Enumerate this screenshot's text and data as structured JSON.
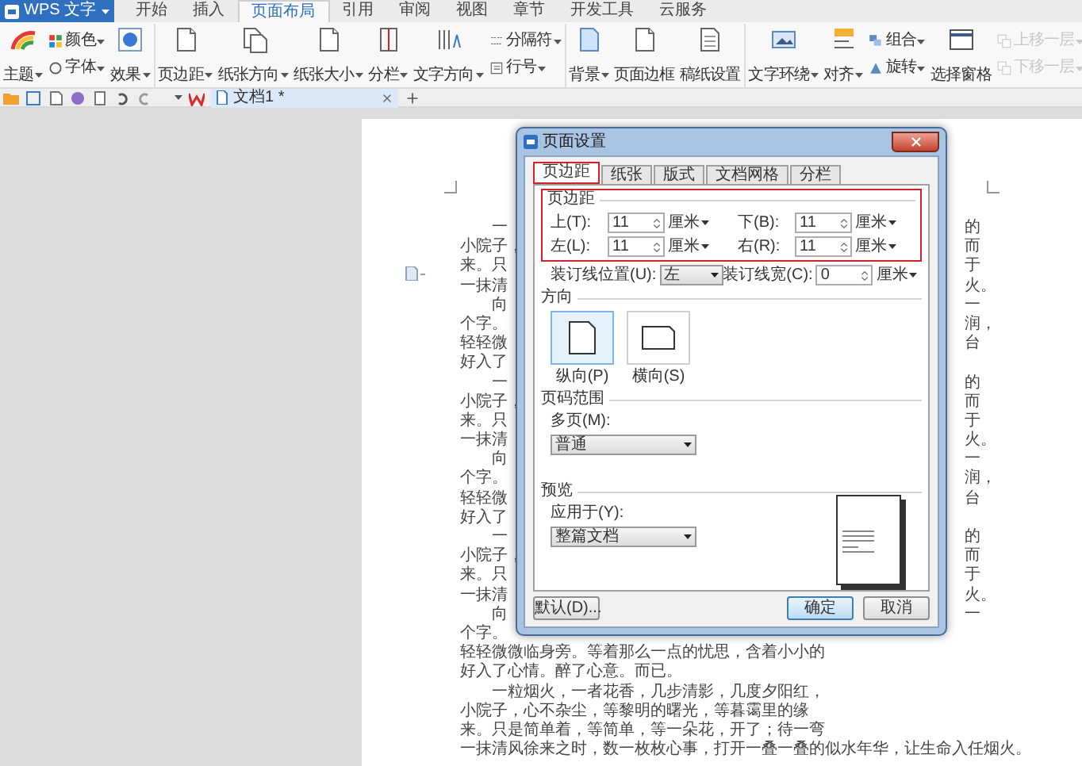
{
  "app_menu": {
    "label": "WPS 文字"
  },
  "menu_tabs": [
    {
      "label": "开始",
      "selected": false
    },
    {
      "label": "插入",
      "selected": false
    },
    {
      "label": "页面布局",
      "selected": true
    },
    {
      "label": "引用",
      "selected": false
    },
    {
      "label": "审阅",
      "selected": false
    },
    {
      "label": "视图",
      "selected": false
    },
    {
      "label": "章节",
      "selected": false
    },
    {
      "label": "开发工具",
      "selected": false
    },
    {
      "label": "云服务",
      "selected": false
    }
  ],
  "ribbon": {
    "groups": [
      {
        "columns": [
          [
            {
              "label": "主题",
              "kind": "large",
              "dropdown": true,
              "disabled": false
            }
          ],
          [
            {
              "label": "颜色",
              "kind": "small",
              "dropdown": true,
              "disabled": false
            },
            {
              "label": "字体",
              "kind": "small",
              "dropdown": true,
              "disabled": false
            }
          ],
          [
            {
              "label": "效果",
              "kind": "large",
              "dropdown": true,
              "disabled": false
            }
          ]
        ]
      },
      {
        "columns": [
          [
            {
              "label": "页边距",
              "kind": "large",
              "dropdown": true,
              "disabled": false
            }
          ],
          [
            {
              "label": "纸张方向",
              "kind": "large",
              "dropdown": true,
              "disabled": false
            }
          ],
          [
            {
              "label": "纸张大小",
              "kind": "large",
              "dropdown": true,
              "disabled": false
            }
          ],
          [
            {
              "label": "分栏",
              "kind": "large",
              "dropdown": true,
              "disabled": false
            }
          ],
          [
            {
              "label": "文字方向",
              "kind": "large",
              "dropdown": true,
              "disabled": false
            }
          ],
          [
            {
              "label": "分隔符",
              "kind": "small",
              "dropdown": true,
              "disabled": false
            },
            {
              "label": "行号",
              "kind": "small",
              "dropdown": true,
              "disabled": false
            }
          ]
        ]
      },
      {
        "columns": [
          [
            {
              "label": "背景",
              "kind": "large",
              "dropdown": true,
              "disabled": false
            }
          ],
          [
            {
              "label": "页面边框",
              "kind": "large",
              "dropdown": false,
              "disabled": false
            }
          ],
          [
            {
              "label": "稿纸设置",
              "kind": "large",
              "dropdown": false,
              "disabled": false
            }
          ]
        ]
      },
      {
        "columns": [
          [
            {
              "label": "文字环绕",
              "kind": "large",
              "dropdown": true,
              "disabled": false
            }
          ],
          [
            {
              "label": "对齐",
              "kind": "large",
              "dropdown": true,
              "disabled": false
            }
          ],
          [
            {
              "label": "组合",
              "kind": "small",
              "dropdown": true,
              "disabled": false
            },
            {
              "label": "旋转",
              "kind": "small",
              "dropdown": true,
              "disabled": false
            }
          ],
          [
            {
              "label": "选择窗格",
              "kind": "large",
              "dropdown": false,
              "disabled": false
            }
          ],
          [
            {
              "label": "上移一层",
              "kind": "small",
              "dropdown": true,
              "disabled": true
            },
            {
              "label": "下移一层",
              "kind": "small",
              "dropdown": true,
              "disabled": true
            }
          ]
        ]
      }
    ]
  },
  "document_tabs": [
    {
      "label": "文档1 *",
      "selected": true
    }
  ],
  "document": {
    "lines": [
      {
        "text": "一",
        "indent": true,
        "right": "的"
      },
      {
        "text": "小院子，",
        "indent": false,
        "right": "而"
      },
      {
        "text": "来。只",
        "indent": false,
        "right": "于"
      },
      {
        "text": "一抹清",
        "indent": false,
        "right": "火。"
      },
      {
        "text": "向",
        "indent": true,
        "right": "一"
      },
      {
        "text": "个字。",
        "indent": false,
        "right": "润，"
      },
      {
        "text": "轻轻微",
        "indent": false,
        "right": "台"
      },
      {
        "text": "好入了",
        "indent": false
      },
      {
        "text": "一",
        "indent": true,
        "right": "的"
      },
      {
        "text": "小院子，",
        "indent": false,
        "right": "而"
      },
      {
        "text": "来。只",
        "indent": false,
        "right": "于"
      },
      {
        "text": "一抹清",
        "indent": false,
        "right": "火。"
      },
      {
        "text": "向",
        "indent": true,
        "right": "一"
      },
      {
        "text": "个字。",
        "indent": false,
        "right": "润，"
      },
      {
        "text": "轻轻微",
        "indent": false,
        "right": "台"
      },
      {
        "text": "好入了",
        "indent": false
      },
      {
        "text": "一",
        "indent": true,
        "right": "的"
      },
      {
        "text": "小院子，",
        "indent": false,
        "right": "而"
      },
      {
        "text": "来。只",
        "indent": false,
        "right": "于"
      },
      {
        "text": "一抹清",
        "indent": false,
        "right": "火。"
      },
      {
        "text": "向",
        "indent": true,
        "right": "一"
      },
      {
        "text": "个字。",
        "indent": false
      },
      {
        "text": "轻轻微微临身旁。等着那么一点的忧思，含着小小的",
        "indent": false
      },
      {
        "text": "好入了心情。醉了心意。而已。",
        "indent": false
      },
      {
        "text": "一粒烟火，一者花香，几步清影，几度夕阳红，",
        "indent": true
      },
      {
        "text": "小院子，心不杂尘，等黎明的曙光，等暮霭里的缘",
        "indent": false
      },
      {
        "text": "来。只是简单着，等简单，等一朵花，开了；待一弯",
        "indent": false
      },
      {
        "text": "一抹清风徐来之时，数一枚枚心事，打开一叠一叠的似水年华，让生命入任烟火。",
        "indent": false
      }
    ]
  },
  "dialog": {
    "title": "页面设置",
    "tabs": [
      {
        "label": "页边距",
        "selected": true,
        "highlighted": true
      },
      {
        "label": "纸张",
        "selected": false,
        "highlighted": false
      },
      {
        "label": "版式",
        "selected": false,
        "highlighted": false
      },
      {
        "label": "文档网格",
        "selected": false,
        "highlighted": false
      },
      {
        "label": "分栏",
        "selected": false,
        "highlighted": false
      }
    ],
    "margins": {
      "heading": "页边距",
      "highlighted": true,
      "fields": [
        {
          "label": "上(T):",
          "value": "11",
          "unit": "厘米"
        },
        {
          "label": "下(B):",
          "value": "11",
          "unit": "厘米"
        },
        {
          "label": "左(L):",
          "value": "11",
          "unit": "厘米"
        },
        {
          "label": "右(R):",
          "value": "11",
          "unit": "厘米"
        }
      ]
    },
    "gutter_position": {
      "label": "装订线位置(U):",
      "value": "左"
    },
    "gutter_width": {
      "label": "装订线宽(C):",
      "value": "0",
      "unit": "厘米"
    },
    "orientation": {
      "heading": "方向",
      "options": [
        {
          "label": "纵向(P)",
          "selected": true
        },
        {
          "label": "横向(S)",
          "selected": false
        }
      ]
    },
    "page_range": {
      "heading": "页码范围",
      "label": "多页(M):",
      "value": "普通"
    },
    "preview": {
      "heading": "预览",
      "label": "应用于(Y):",
      "value": "整篇文档"
    },
    "buttons": [
      {
        "label": "默认(D)...",
        "kind": "secondary"
      },
      {
        "label": "确定",
        "kind": "primary"
      },
      {
        "label": "取消",
        "kind": "secondary"
      }
    ]
  }
}
